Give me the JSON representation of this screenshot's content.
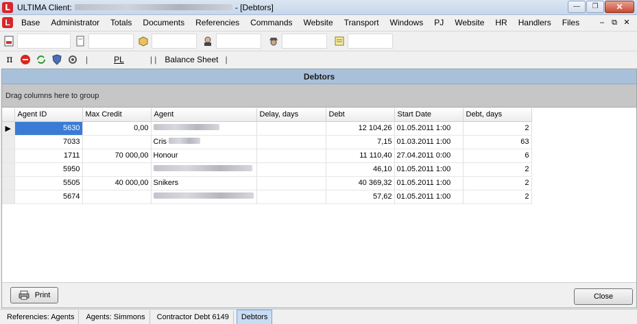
{
  "window": {
    "title_prefix": "ULTIMA Client:",
    "title_suffix": "- [Debtors]",
    "logo_letter": "L"
  },
  "menu": [
    "Base",
    "Administrator",
    "Totals",
    "Documents",
    "Referencies",
    "Commands",
    "Website",
    "Transport",
    "Windows",
    "PJ",
    "Website",
    "HR",
    "Handlers",
    "Files"
  ],
  "toolbar2": {
    "pl_label": "PL",
    "balance_label": "Balance Sheet",
    "sep1": "|",
    "sep2": "| |",
    "sep3": "|"
  },
  "panel": {
    "title": "Debtors",
    "group_hint": "Drag columns here to group"
  },
  "grid": {
    "columns": [
      "Agent ID",
      "Max Credit",
      "Agent",
      "Delay, days",
      "Debt",
      "Start Date",
      "Debt, days"
    ],
    "rows": [
      {
        "agent_id": "5630",
        "max_credit": "0,00",
        "agent": "",
        "delay": "",
        "debt": "12 104,26",
        "start_date": "01.05.2011 1:00",
        "debt_days": "2"
      },
      {
        "agent_id": "7033",
        "max_credit": "",
        "agent": "Cris",
        "delay": "",
        "debt": "7,15",
        "start_date": "01.03.2011 1:00",
        "debt_days": "63"
      },
      {
        "agent_id": "1711",
        "max_credit": "70 000,00",
        "agent": "Honour",
        "delay": "",
        "debt": "11 110,40",
        "start_date": "27.04.2011 0:00",
        "debt_days": "6"
      },
      {
        "agent_id": "5950",
        "max_credit": "",
        "agent": "",
        "delay": "",
        "debt": "46,10",
        "start_date": "01.05.2011 1:00",
        "debt_days": "2"
      },
      {
        "agent_id": "5505",
        "max_credit": "40 000,00",
        "agent": "Snikers",
        "delay": "",
        "debt": "40 369,32",
        "start_date": "01.05.2011 1:00",
        "debt_days": "2"
      },
      {
        "agent_id": "5674",
        "max_credit": "",
        "agent": "",
        "delay": "",
        "debt": "57,62",
        "start_date": "01.05.2011 1:00",
        "debt_days": "2"
      }
    ]
  },
  "buttons": {
    "print": "Print",
    "close": "Close"
  },
  "tasks": [
    "Referencies: Agents",
    "Agents: Simmons",
    "Contractor Debt 6149",
    "Debtors"
  ],
  "colors": {
    "panel_header": "#a9c0da",
    "group_area": "#c6c6c6",
    "selection": "#3a7bd5",
    "logo_red": "#d8262c"
  }
}
